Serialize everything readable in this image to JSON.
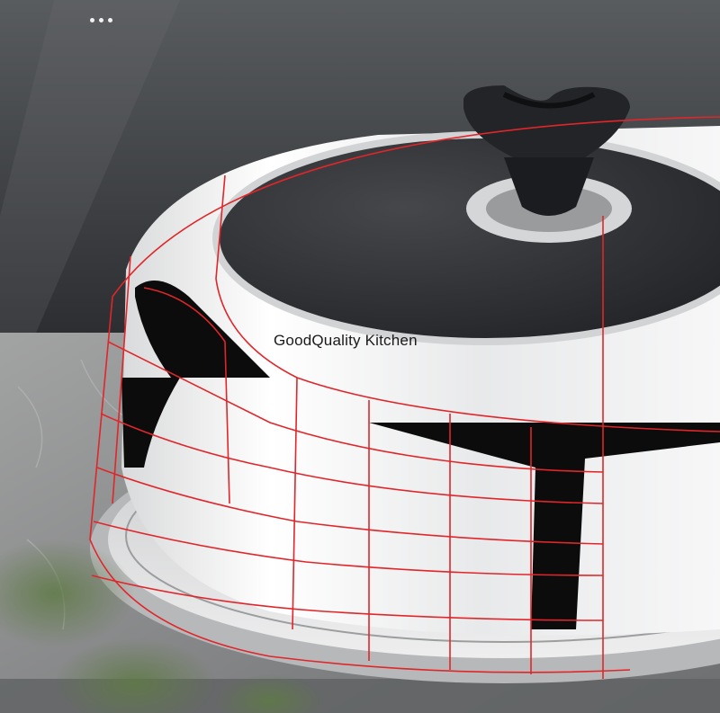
{
  "watermark": {
    "text": "GoodQuality Kitchen"
  },
  "icons": {
    "more": "more-dots-icon"
  },
  "colors": {
    "wall_top": "#545759",
    "wall_bottom": "#2f3134",
    "counter": "#8e8f90",
    "guide_lines": "#e0262a",
    "lid_glass": "#2b2d31",
    "knob": "#1e1f22"
  }
}
